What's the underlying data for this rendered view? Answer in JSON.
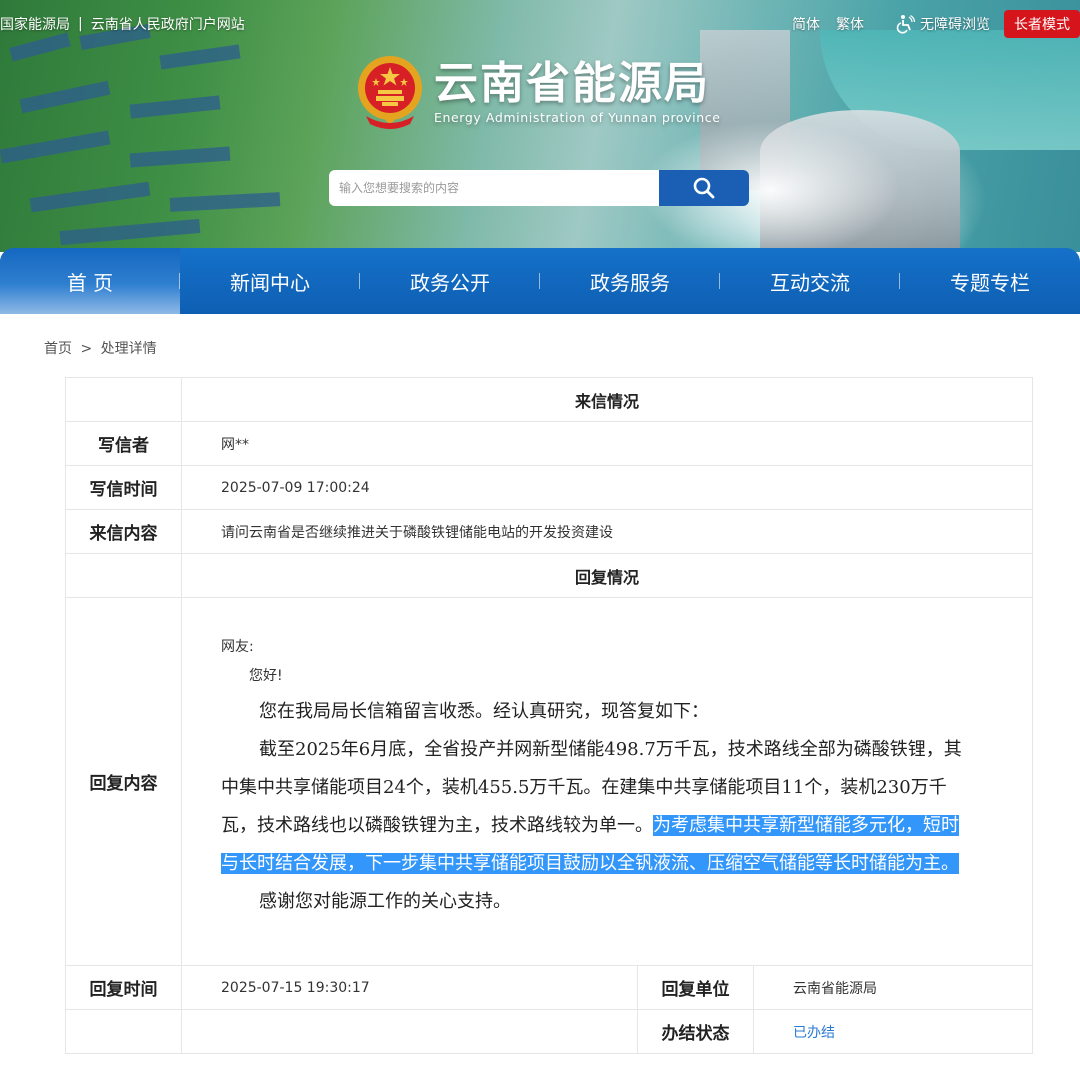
{
  "header": {
    "top_links": [
      "国家能源局",
      "云南省人民政府门户网站"
    ],
    "lang_simplified": "简体",
    "lang_traditional": "繁体",
    "accessibility": "无障碍浏览",
    "elder_mode": "长者模式",
    "site_title": "云南省能源局",
    "site_subtitle": "Energy Administration of Yunnan province",
    "search_placeholder": "输入您想要搜索的内容"
  },
  "nav": {
    "items": [
      "首 页",
      "新闻中心",
      "政务公开",
      "政务服务",
      "互动交流",
      "专题专栏"
    ]
  },
  "breadcrumb": {
    "home": "首页",
    "separator": ">",
    "current": "处理详情"
  },
  "letter": {
    "section_title": "来信情况",
    "writer_label": "写信者",
    "writer": "网**",
    "time_label": "写信时间",
    "time": "2025-07-09 17:00:24",
    "content_label": "来信内容",
    "content": "请问云南省是否继续推进关于磷酸铁锂储能电站的开发投资建设"
  },
  "reply": {
    "section_title": "回复情况",
    "content_label": "回复内容",
    "greeting": "网友:",
    "hello": "您好!",
    "p1": "您在我局局长信箱留言收悉。经认真研究，现答复如下：",
    "p2_plain": "截至2025年6月底，全省投产并网新型储能498.7万千瓦，技术路线全部为磷酸铁锂，其中集中共享储能项目24个，装机455.5万千瓦。在建集中共享储能项目11个，装机230万千瓦，技术路线也以磷酸铁锂为主，技术路线较为单一。",
    "p2_highlight": "为考虑集中共享新型储能多元化，短时与长时结合发展，下一步集中共享储能项目鼓励以全钒液流、压缩空气储能等长时储能为主。",
    "p3": "感谢您对能源工作的关心支持。",
    "time_label": "回复时间",
    "time": "2025-07-15 19:30:17",
    "unit_label": "回复单位",
    "unit": "云南省能源局",
    "status_label": "办结状态",
    "status": "已办结"
  },
  "colors": {
    "nav_blue": "#0e5fb3",
    "elder_red": "#d5151b",
    "highlight": "#3296fa",
    "status_link": "#2a7ad5"
  }
}
